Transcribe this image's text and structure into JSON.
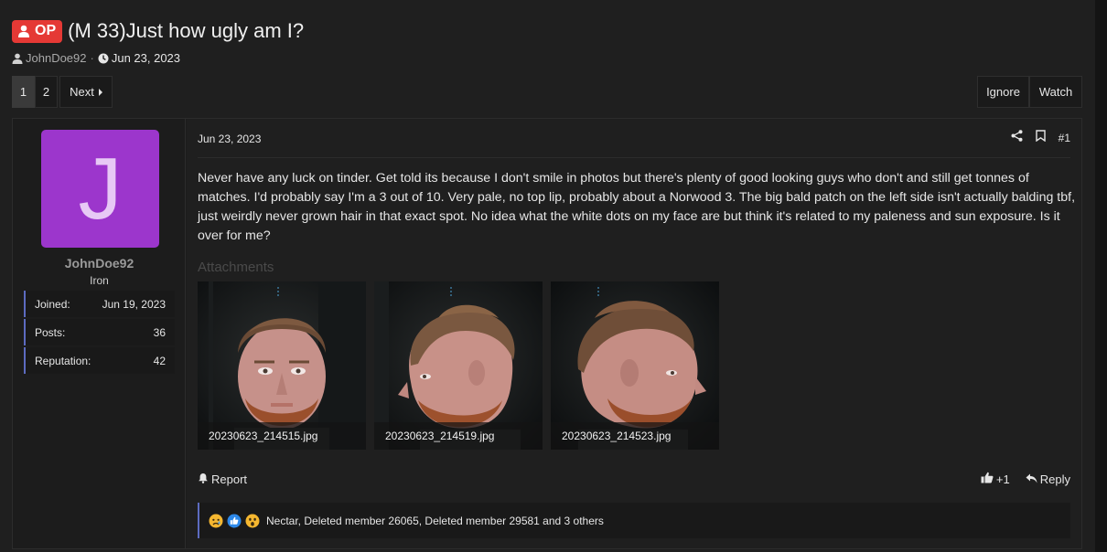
{
  "thread": {
    "badge": "OP",
    "title": "(M 33)Just how ugly am I?",
    "author": "JohnDoe92",
    "date": "Jun 23, 2023"
  },
  "pagination": {
    "pages": [
      "1",
      "2"
    ],
    "current": "1",
    "next_label": "Next"
  },
  "thread_actions": {
    "ignore": "Ignore",
    "watch": "Watch"
  },
  "user": {
    "avatar_letter": "J",
    "avatar_color": "#9c36cc",
    "name": "JohnDoe92",
    "rank": "Iron",
    "stats": [
      {
        "label": "Joined:",
        "value": "Jun 19, 2023"
      },
      {
        "label": "Posts:",
        "value": "36"
      },
      {
        "label": "Reputation:",
        "value": "42"
      }
    ]
  },
  "post": {
    "date": "Jun 23, 2023",
    "number": "#1",
    "body": "Never have any luck on tinder. Get told its because I don't smile in photos but there's plenty of good looking guys who don't and still get tonnes of matches. I'd probably say I'm a 3 out of 10. Very pale, no top lip, probably about a Norwood 3. The big bald patch on the left side isn't actually balding tbf, just weirdly never grown hair in that exact spot. No idea what the white dots on my face are but think it's related to my paleness and sun exposure. Is it over for me?",
    "attachments_label": "Attachments",
    "attachments": [
      {
        "filename": "20230623_214515.jpg"
      },
      {
        "filename": "20230623_214519.jpg"
      },
      {
        "filename": "20230623_214523.jpg"
      }
    ],
    "report_label": "Report",
    "like_label": "+1",
    "reply_label": "Reply"
  },
  "reactions": {
    "emojis": [
      "sad-emoji",
      "like-emoji",
      "wow-emoji"
    ],
    "text": "Nectar, Deleted member 26065, Deleted member 29581 and 3 others"
  },
  "colors": {
    "accent": "#5c6bc0",
    "op_badge": "#e53935",
    "background": "#1f1f1f"
  }
}
